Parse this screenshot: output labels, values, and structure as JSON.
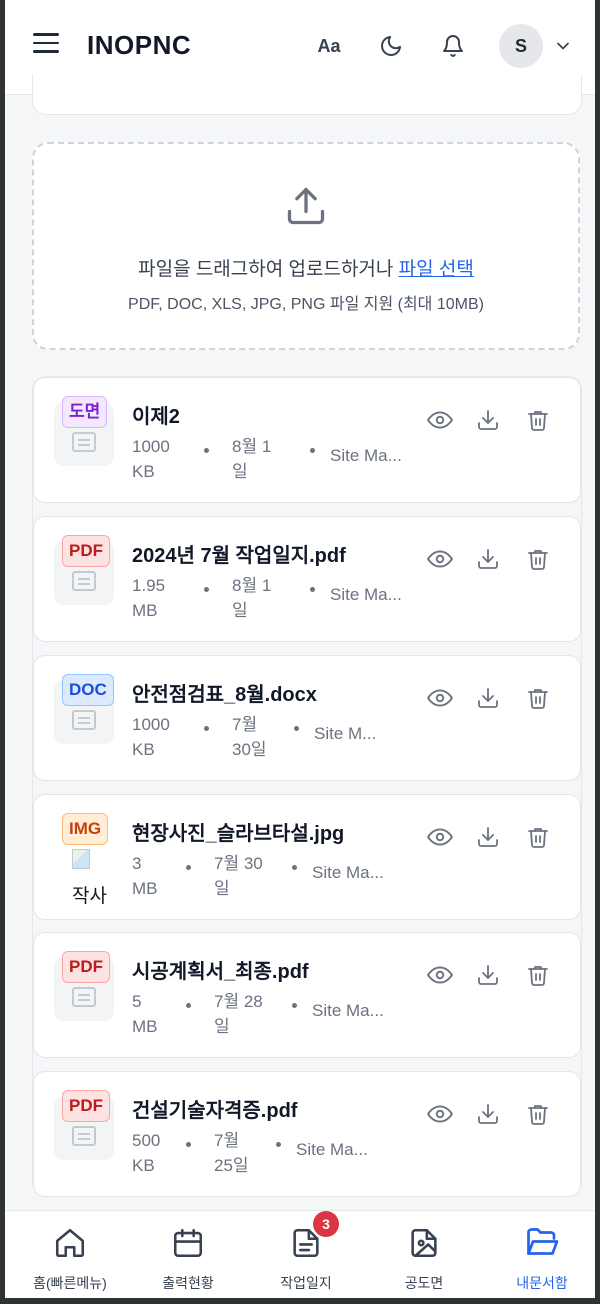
{
  "header": {
    "brand": "INOPNC",
    "font_size_button": "Aa",
    "user_initial": "S",
    "icons": [
      "menu-icon",
      "moon-icon",
      "bell-icon",
      "chevron-down-icon"
    ]
  },
  "upload": {
    "text": "파일을 드래그하여 업로드하거나",
    "link": "파일 선택",
    "hint": "PDF, DOC, XLS, JPG, PNG 파일 지원 (최대 10MB)",
    "icon": "upload-icon"
  },
  "files": [
    {
      "badge": "도면",
      "badge_color": "#7e22ce",
      "badge_bg": "#f3e8ff",
      "badge_border": "#d8b4fe",
      "name": "이제2",
      "size": "1000\nKB",
      "date": "8월 1\n일",
      "uploader": "Site Ma...",
      "is_image": false
    },
    {
      "badge": "PDF",
      "badge_color": "#b91c1c",
      "badge_bg": "#fee2e2",
      "badge_border": "#fca5a5",
      "name": "2024년 7월 작업일지.pdf",
      "size": "1.95\nMB",
      "date": "8월 1\n일",
      "uploader": "Site Ma...",
      "is_image": false
    },
    {
      "badge": "DOC",
      "badge_color": "#1d4ed8",
      "badge_bg": "#dbeafe",
      "badge_border": "#93c5fd",
      "name": "안전점검표_8월.docx",
      "size": "1000\nKB",
      "date": "7월\n30일",
      "uploader": "Site M...",
      "is_image": false
    },
    {
      "badge": "IMG",
      "badge_color": "#c2410c",
      "badge_bg": "#ffedd5",
      "badge_border": "#fdba74",
      "name": "현장사진_슬라브타설.jpg",
      "size": "3\nMB",
      "date": "7월 30\n일",
      "uploader": "Site Ma...",
      "is_image": true,
      "alt": "작사"
    },
    {
      "badge": "PDF",
      "badge_color": "#b91c1c",
      "badge_bg": "#fee2e2",
      "badge_border": "#fca5a5",
      "name": "시공계획서_최종.pdf",
      "size": "5\nMB",
      "date": "7월 28\n일",
      "uploader": "Site Ma...",
      "is_image": false
    },
    {
      "badge": "PDF",
      "badge_color": "#b91c1c",
      "badge_bg": "#fee2e2",
      "badge_border": "#fca5a5",
      "name": "건설기술자격증.pdf",
      "size": "500\nKB",
      "date": "7월\n25일",
      "uploader": "Site Ma...",
      "is_image": false
    }
  ],
  "nav": [
    {
      "label": "홈(빠른메뉴)",
      "icon": "home-icon",
      "active": false
    },
    {
      "label": "출력현황",
      "icon": "calendar-icon",
      "active": false
    },
    {
      "label": "작업일지",
      "icon": "document-icon",
      "active": false,
      "badge": "3"
    },
    {
      "label": "공도면",
      "icon": "blueprint-icon",
      "active": false
    },
    {
      "label": "내문서함",
      "icon": "folder-open-icon",
      "active": true
    }
  ],
  "colors": {
    "accent": "#2563eb",
    "badge_red": "#dc3545"
  }
}
